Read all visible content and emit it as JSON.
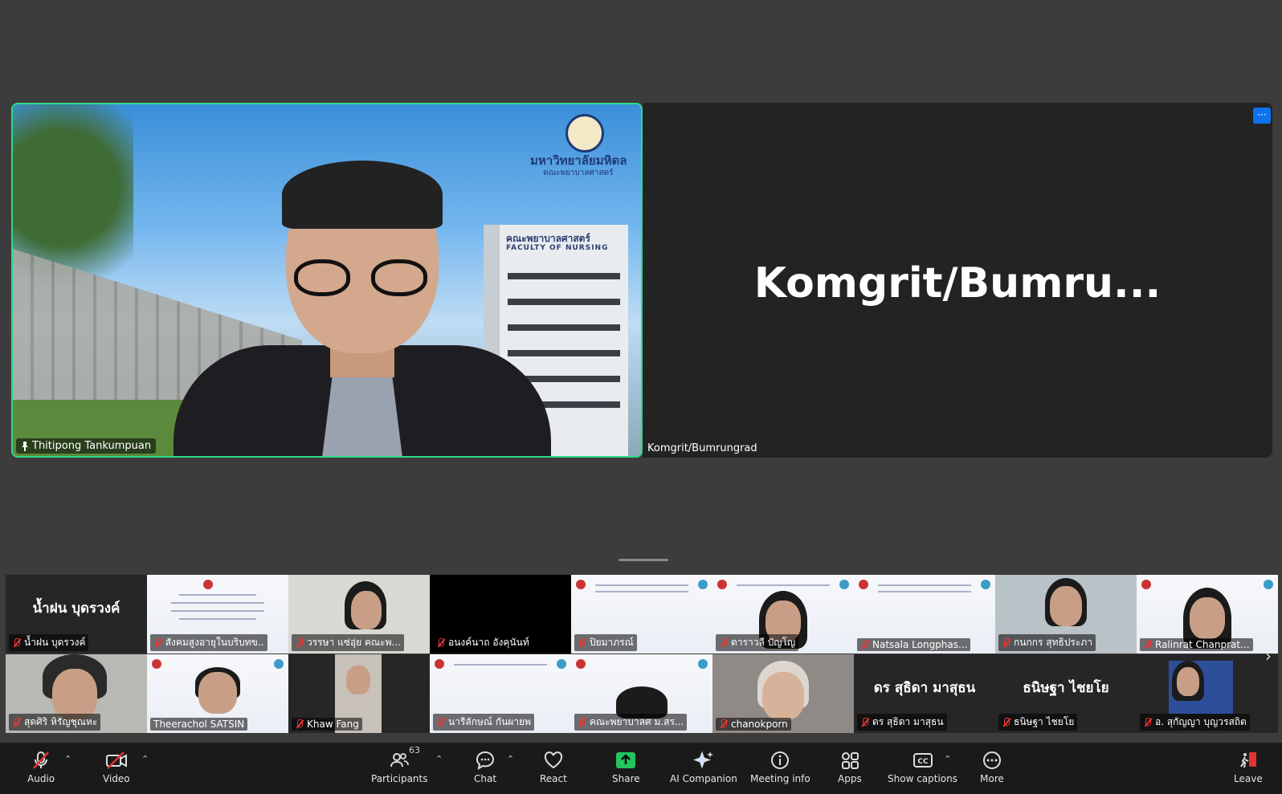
{
  "main": {
    "speaker": {
      "name": "Thitipong Tankumpuan",
      "logo_text": "มหาวิทยาลัยมหิดล",
      "logo_sub": "คณะพยาบาลศาสตร์",
      "building_sign": "คณะพยาบาลศาสตร์",
      "building_sign2": "FACULTY OF NURSING"
    },
    "second": {
      "big_name": "Komgrit/Bumru...",
      "name": "Komgrit/Bumrungrad"
    },
    "more_label": "···"
  },
  "gallery": {
    "row1": [
      {
        "name": "น้ำฝน บุดรวงค์",
        "big": "น้ำฝน บุดรวงค์",
        "kind": "dark"
      },
      {
        "name": "สังคมสูงอายุในบริบทข...",
        "kind": "slide"
      },
      {
        "name": "วรรษา แซ่อุ่ย คณะพ...",
        "kind": "cam"
      },
      {
        "name": "อนงค์นาถ อังคุนันท์",
        "kind": "black"
      },
      {
        "name": "ปิยมาภรณ์",
        "kind": "slide"
      },
      {
        "name": "ดาราวลี ปัญโญ",
        "kind": "slide"
      },
      {
        "name": "Natsala Longphas...",
        "kind": "slide"
      },
      {
        "name": "กนกกร สุทธิประภา",
        "kind": "cam"
      },
      {
        "name": "Ralinrat Chanprat...",
        "kind": "slide"
      }
    ],
    "row2": [
      {
        "name": "สุดศิริ หิรัญชุณหะ",
        "kind": "cam"
      },
      {
        "name": "Theerachol SATSIN",
        "kind": "slide"
      },
      {
        "name": "Khaw Fang",
        "kind": "dark"
      },
      {
        "name": "นารีลักษณ์ กันผายพ",
        "kind": "slide"
      },
      {
        "name": "คณะพยาบาลศ ม.สร...",
        "kind": "slide"
      },
      {
        "name": "chanokporn",
        "kind": "cam"
      },
      {
        "name": "ดร สุธิดา มาสุธน",
        "big": "ดร สุธิดา มาสุธน",
        "kind": "dark"
      },
      {
        "name": "ธนิษฐา ไชยโย",
        "big": "ธนิษฐา  ไชยโย",
        "kind": "dark"
      },
      {
        "name": "อ. สุกัญญา บุญวรสถิต",
        "kind": "dark"
      }
    ]
  },
  "toolbar": {
    "audio": "Audio",
    "video": "Video",
    "participants": "Participants",
    "participants_count": "63",
    "chat": "Chat",
    "react": "React",
    "share": "Share",
    "ai": "AI Companion",
    "info": "Meeting info",
    "apps": "Apps",
    "captions": "Show captions",
    "more": "More",
    "leave": "Leave"
  },
  "colors": {
    "active_border": "#2dd98a",
    "share_green": "#23c55e",
    "accent_blue": "#0e72ed",
    "muted_red": "#e33333"
  }
}
